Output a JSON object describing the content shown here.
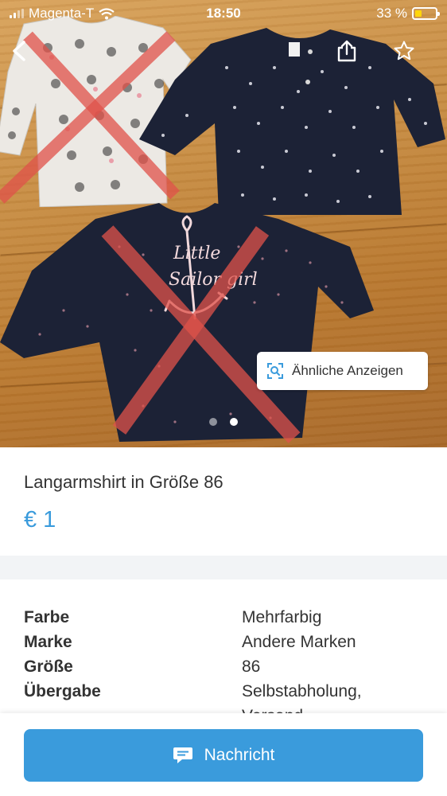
{
  "status_bar": {
    "carrier": "Magenta-T",
    "time": "18:50",
    "battery": "33 %",
    "battery_level": 0.33
  },
  "gallery": {
    "similar_button_label": "Ähnliche Anzeigen",
    "page_count": 2,
    "current_page": 2
  },
  "listing": {
    "title": "Langarmshirt in Größe 86",
    "price": "€ 1"
  },
  "details": [
    {
      "key": "Farbe",
      "value": "Mehrfarbig"
    },
    {
      "key": "Marke",
      "value": "Andere Marken"
    },
    {
      "key": "Größe",
      "value": "86"
    },
    {
      "key": "Übergabe",
      "value": "Selbstabholung,"
    },
    {
      "key": "",
      "value": "Versand"
    }
  ],
  "bottom": {
    "message_label": "Nachricht"
  },
  "colors": {
    "accent": "#3a9bdc",
    "navy_shirt": "#1c2236",
    "cross_red": "#e0524a",
    "battery_fill": "#ffd60a"
  },
  "icons": [
    "back-chevron-icon",
    "share-icon",
    "star-icon",
    "scan-search-icon",
    "chat-bubble-icon",
    "wifi-icon",
    "signal-icon"
  ]
}
